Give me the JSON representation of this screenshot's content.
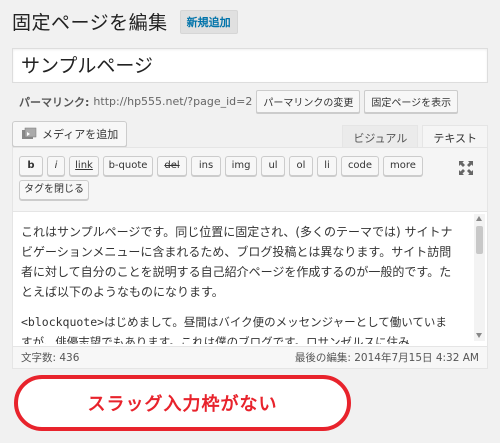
{
  "header": {
    "title": "固定ページを編集",
    "add_new_label": "新規追加"
  },
  "post": {
    "title": "サンプルページ"
  },
  "permalink": {
    "label": "パーマリンク:",
    "url": "http://hp555.net/?page_id=2",
    "change_button": "パーマリンクの変更",
    "view_button": "固定ページを表示"
  },
  "media": {
    "add_media_label": "メディアを追加",
    "icon": "media-icon"
  },
  "tabs": [
    {
      "label": "ビジュアル",
      "active": false
    },
    {
      "label": "テキスト",
      "active": true
    }
  ],
  "quicktags": {
    "row1": [
      "b",
      "i",
      "link",
      "b-quote",
      "del",
      "ins",
      "img",
      "ul",
      "ol",
      "li",
      "code",
      "more"
    ],
    "row2": [
      "タグを閉じる"
    ],
    "fullscreen_icon": "expand-icon"
  },
  "content": {
    "paragraph1": "これはサンプルページです。同じ位置に固定され、(多くのテーマでは) サイトナビゲーションメニューに含まれるため、ブログ投稿とは異なります。サイト訪問者に対して自分のことを説明する自己紹介ページを作成するのが一般的です。たとえば以下のようなものになります。",
    "paragraph2": "<blockquote>はじめまして。昼間はバイク便のメッセンジャーとして働いていますが、俳優志望でもあります。これは僕のブログです。ロサンゼルスに住み"
  },
  "status": {
    "word_count": "文字数: 436",
    "last_edited": "最後の編集: 2014年7月15日 4:32 AM"
  },
  "annotation": {
    "text": "スラッグ入力枠がない"
  },
  "colors": {
    "annotation_red": "#e8232c",
    "link_blue": "#0073aa",
    "background": "#f1f1f1"
  }
}
